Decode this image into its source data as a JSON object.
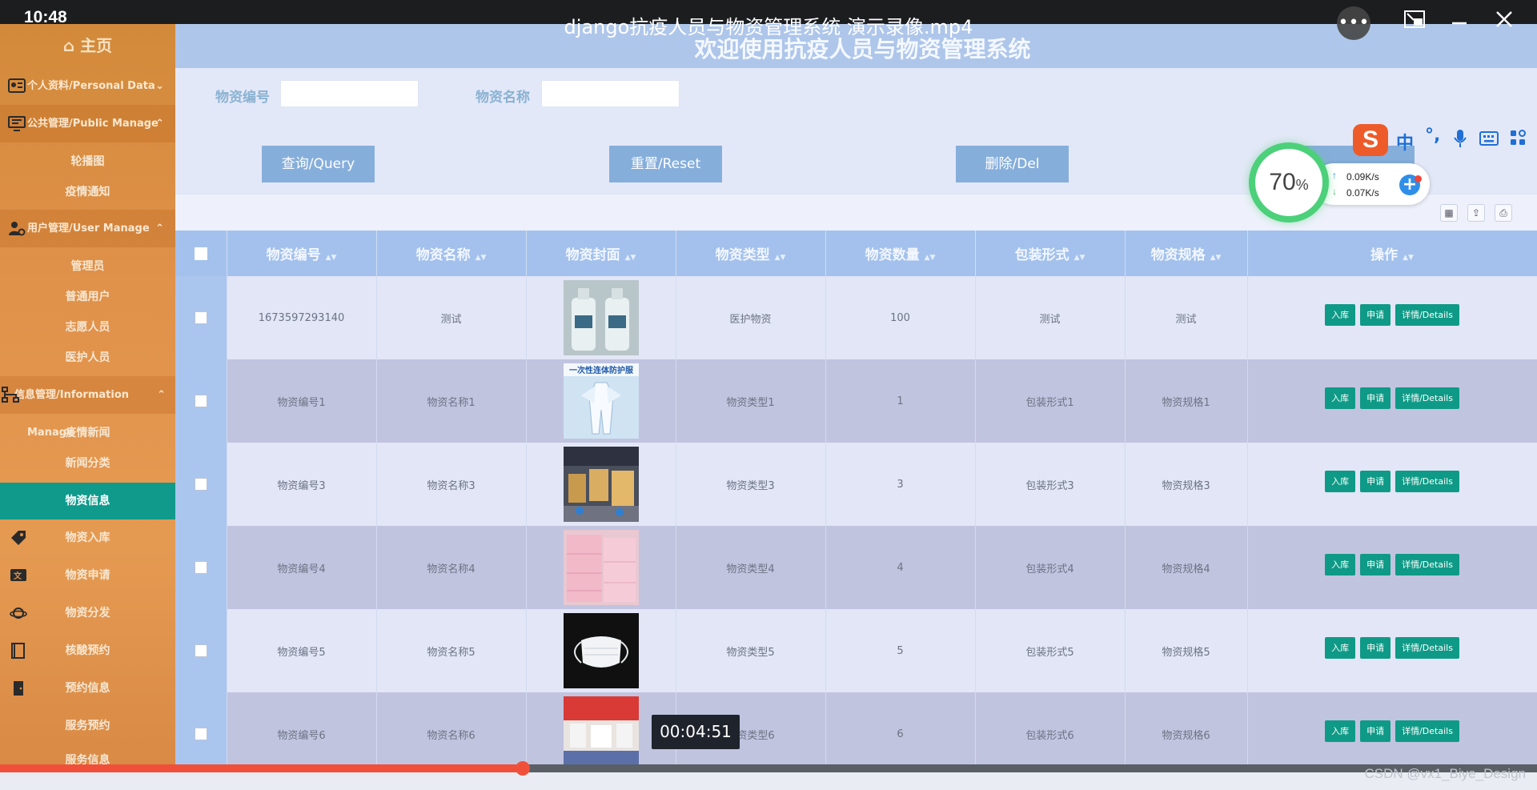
{
  "player": {
    "clock": "10:48",
    "title": "django抗疫人员与物资管理系统 演示录像.mp4",
    "time_display": "00:04:51",
    "progress": 0.34,
    "watermark": "CSDN @vx1_Biye_Design"
  },
  "sidebar": {
    "home": "⌂ 主页",
    "groups": {
      "personal": "个人资料/Personal Data",
      "public": "公共管理/Public Manage",
      "user": "用户管理/User Manage",
      "info": "信息管理/Information Manage"
    },
    "public_items": [
      "轮播图",
      "疫情通知"
    ],
    "user_items": [
      "管理员",
      "普通用户",
      "志愿人员",
      "医护人员"
    ],
    "info_items": [
      "疫情新闻",
      "新闻分类",
      "物资信息"
    ],
    "icon_items": [
      "物资入库",
      "物资申请",
      "物资分发",
      "核酸预约",
      "预约信息",
      "服务预约",
      "服务信息"
    ]
  },
  "header": {
    "title": "欢迎使用抗疫人员与物资管理系统"
  },
  "search": {
    "code_label": "物资编号",
    "name_label": "物资名称",
    "code_value": "",
    "name_value": ""
  },
  "actions": {
    "query": "查询/Query",
    "reset": "重置/Reset",
    "delete": "删除/Del"
  },
  "table": {
    "columns": [
      "物资编号",
      "物资名称",
      "物资封面",
      "物资类型",
      "物资数量",
      "包装形式",
      "物资规格",
      "操作"
    ],
    "op_labels": {
      "stock_in": "入库",
      "apply": "申请",
      "details": "详情/Details"
    },
    "rows": [
      {
        "code": "1673597293140",
        "name": "测试",
        "type": "医护物资",
        "qty": "100",
        "pack": "测试",
        "spec": "测试"
      },
      {
        "code": "物资编号1",
        "name": "物资名称1",
        "type": "物资类型1",
        "qty": "1",
        "pack": "包装形式1",
        "spec": "物资规格1"
      },
      {
        "code": "物资编号3",
        "name": "物资名称3",
        "type": "物资类型3",
        "qty": "3",
        "pack": "包装形式3",
        "spec": "物资规格3"
      },
      {
        "code": "物资编号4",
        "name": "物资名称4",
        "type": "物资类型4",
        "qty": "4",
        "pack": "包装形式4",
        "spec": "物资规格4"
      },
      {
        "code": "物资编号5",
        "name": "物资名称5",
        "type": "物资类型5",
        "qty": "5",
        "pack": "包装形式5",
        "spec": "物资规格5"
      },
      {
        "code": "物资编号6",
        "name": "物资名称6",
        "type": "物资类型6",
        "qty": "6",
        "pack": "包装形式6",
        "spec": "物资规格6"
      }
    ],
    "thumb_caption_row2": "一次性连体防护服"
  },
  "ime": {
    "logo": "S",
    "mode": "中",
    "punct": "°,"
  },
  "netspeed": {
    "percent": "70",
    "percent_sign": "%",
    "up": "0.09K/s",
    "down": "0.07K/s"
  },
  "colors": {
    "sidebar": "#e0914a",
    "active_item": "#0f9a8c",
    "header": "#aec6ea",
    "button": "#86aedb",
    "op_button": "#0e9a86",
    "progress": "#f0503a"
  }
}
